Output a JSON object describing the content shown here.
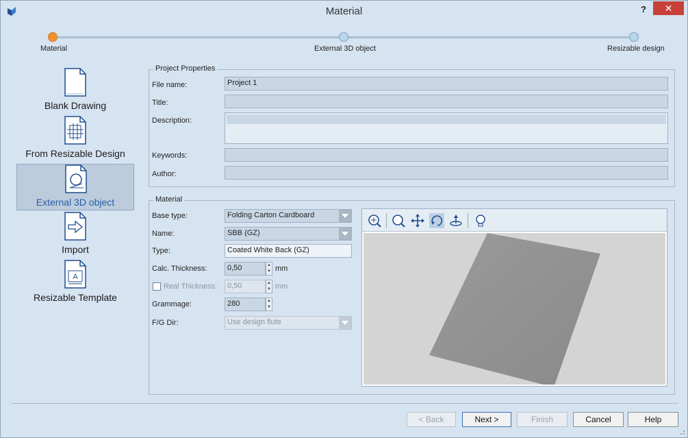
{
  "window": {
    "title": "Material",
    "help_label": "?",
    "close_label": "✕"
  },
  "steps": [
    {
      "label": "Material",
      "state": "active"
    },
    {
      "label": "External 3D object",
      "state": "pending"
    },
    {
      "label": "Resizable design",
      "state": "pending"
    }
  ],
  "nav": [
    {
      "label": "Blank Drawing",
      "icon": "blank-document-icon",
      "selected": false
    },
    {
      "label": "From Resizable Design",
      "icon": "carton-design-icon",
      "selected": false
    },
    {
      "label": "External 3D object",
      "icon": "3d-object-icon",
      "selected": true
    },
    {
      "label": "Import",
      "icon": "import-arrow-icon",
      "selected": false
    },
    {
      "label": "Resizable Template",
      "icon": "template-icon",
      "selected": false
    }
  ],
  "project": {
    "group_title": "Project Properties",
    "file_name_label": "File name:",
    "file_name_value": "Project 1",
    "title_label": "Title:",
    "title_value": "",
    "description_label": "Description:",
    "description_value": "",
    "keywords_label": "Keywords:",
    "keywords_value": "",
    "author_label": "Author:",
    "author_value": ""
  },
  "material": {
    "group_title": "Material",
    "base_type_label": "Base type:",
    "base_type_value": "Folding Carton Cardboard",
    "name_label": "Name:",
    "name_value": "SBB (GZ)",
    "type_label": "Type:",
    "type_value": "Coated White Back (GZ)",
    "calc_thickness_label": "Calc. Thickness:",
    "calc_thickness_value": "0,50",
    "calc_thickness_unit": "mm",
    "real_thickness_label": "Real Thickness:",
    "real_thickness_value": "0,50",
    "real_thickness_unit": "mm",
    "real_thickness_checked": false,
    "grammage_label": "Grammage:",
    "grammage_value": "280",
    "fg_dir_label": "F/G Dir:",
    "fg_dir_value": "Use design flute"
  },
  "viewer_toolbar": [
    "zoom-window-icon",
    "zoom-fit-icon",
    "pan-icon",
    "rotate-icon",
    "orbit-icon",
    "light-bulb-icon"
  ],
  "buttons": {
    "back": "< Back",
    "next": "Next >",
    "finish": "Finish",
    "cancel": "Cancel",
    "help": "Help"
  },
  "colors": {
    "accent_step": "#f0922e",
    "close_button": "#c7413a",
    "selected_nav_text": "#2a5ea8"
  }
}
